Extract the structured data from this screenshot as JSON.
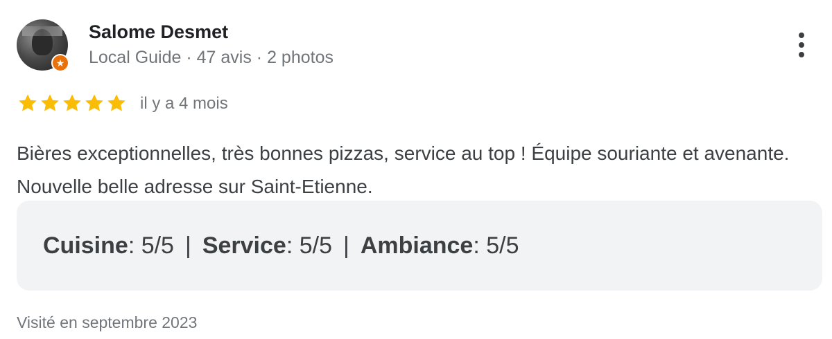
{
  "reviewer": {
    "name": "Salome Desmet",
    "meta": "Local Guide · 47 avis · 2 photos",
    "avatar_icon": "profile-photo",
    "badge_icon": "local-guide-star-icon"
  },
  "menu": {
    "icon": "more-vert-icon"
  },
  "rating": {
    "stars": 5,
    "max": 5,
    "star_color": "#fbbc04",
    "time": "il y a 4 mois"
  },
  "text": "Bières exceptionnelles, très bonnes pizzas, service au top ! Équipe souriante et avenante. Nouvelle belle adresse sur Saint-Etienne.",
  "sub_ratings": [
    {
      "label": "Cuisine",
      "value": " : 5/5"
    },
    {
      "label": "Service",
      "value": " : 5/5"
    },
    {
      "label": "Ambiance",
      "value": " : 5/5"
    }
  ],
  "separator": "|",
  "visited": "Visité en septembre 2023"
}
